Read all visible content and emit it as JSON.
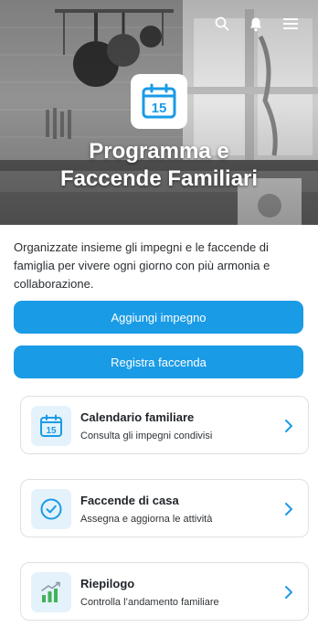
{
  "hero": {
    "title_line1": "Programma e",
    "title_line2": "Faccende Familiari",
    "badge_number": "15"
  },
  "topbar": {
    "icons": [
      "search-icon",
      "bell-icon",
      "menu-icon"
    ]
  },
  "intro": {
    "text": "Organizzate insieme gli impegni e le faccende di famiglia per vivere ogni giorno con più armonia e collaborazione."
  },
  "actions": {
    "add_label": "Aggiungi impegno",
    "log_label": "Registra faccenda"
  },
  "cards": [
    {
      "title": "Calendario familiare",
      "subtitle": "Consulta gli impegni condivisi",
      "icon": "calendar-icon",
      "icon_number": "15"
    },
    {
      "title": "Faccende di casa",
      "subtitle": "Assegna e aggiorna le attività",
      "icon": "check-circle-icon"
    },
    {
      "title": "Riepilogo",
      "subtitle": "Controlla l’andamento familiare",
      "icon": "chart-icon"
    }
  ],
  "colors": {
    "accent": "#1a9be6",
    "card_icon_bg": "#e4f2fb",
    "chart_green": "#43b25a"
  }
}
